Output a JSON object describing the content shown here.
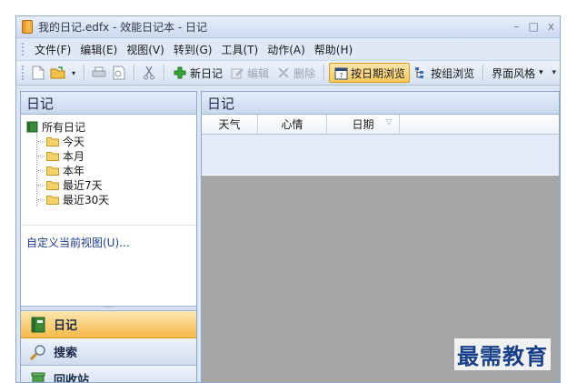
{
  "window": {
    "title": "我的日记.edfx - 效能日记本 - 日记",
    "minimize_glyph": "–",
    "maximize_glyph": "□",
    "close_glyph": "x"
  },
  "menu": {
    "items": [
      "文件(F)",
      "编辑(E)",
      "视图(V)",
      "转到(G)",
      "工具(T)",
      "动作(A)",
      "帮助(H)"
    ]
  },
  "toolbar": {
    "new_diary": "新日记",
    "edit": "编辑",
    "delete": "删除",
    "browse_by_date": "按日期浏览",
    "browse_by_group": "按组浏览",
    "ui_style": "界面风格",
    "dropdown_glyph": "▾",
    "overflow_glyph": "▾"
  },
  "left_pane": {
    "title": "日记",
    "tree_root": "所有日记",
    "tree_items": [
      "今天",
      "本月",
      "本年",
      "最近7天",
      "最近30天"
    ],
    "custom_view": "自定义当前视图(U)...",
    "splitter_dots": "·····",
    "nav": [
      {
        "label": "日记",
        "icon": "diary-book-icon",
        "active": true
      },
      {
        "label": "搜索",
        "icon": "magnifier-icon",
        "active": false
      },
      {
        "label": "回收站",
        "icon": "recycle-bin-icon",
        "active": false
      }
    ]
  },
  "right_pane": {
    "title": "日记",
    "columns": [
      "天气",
      "心情",
      "日期"
    ],
    "sort_glyph": "▽"
  },
  "watermark": {
    "text": "最需教育"
  },
  "colors": {
    "active_nav": "#f6b949",
    "active_button": "#f7c95c",
    "preview_background": "#a6a6a6",
    "frame_blue": "#8fa9cc"
  }
}
